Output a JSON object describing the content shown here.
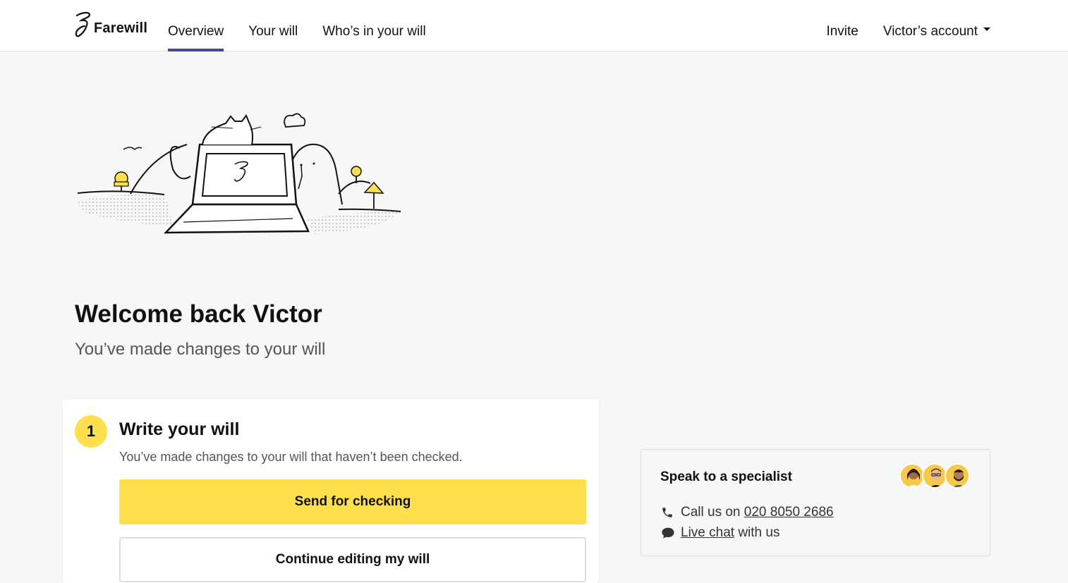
{
  "header": {
    "logo_text": "Farewill",
    "nav": [
      {
        "label": "Overview",
        "active": true
      },
      {
        "label": "Your will",
        "active": false
      },
      {
        "label": "Who’s in your will",
        "active": false
      }
    ],
    "invite_label": "Invite",
    "account_label": "Victor’s account"
  },
  "main": {
    "welcome": "Welcome back Victor",
    "subtitle": "You’ve made changes to your will"
  },
  "step_card": {
    "number": "1",
    "title": "Write your will",
    "text": "You’ve made changes to your will that haven’t been checked.",
    "primary_button": "Send for checking",
    "secondary_button": "Continue editing my will"
  },
  "specialist": {
    "title": "Speak to a specialist",
    "call_prefix": "Call us on ",
    "phone": "020 8050 2686",
    "chat_link": "Live chat",
    "chat_suffix": " with us"
  },
  "colors": {
    "accent_yellow": "#fedf4d",
    "nav_underline": "#434a88",
    "background": "#f7f7f7"
  }
}
